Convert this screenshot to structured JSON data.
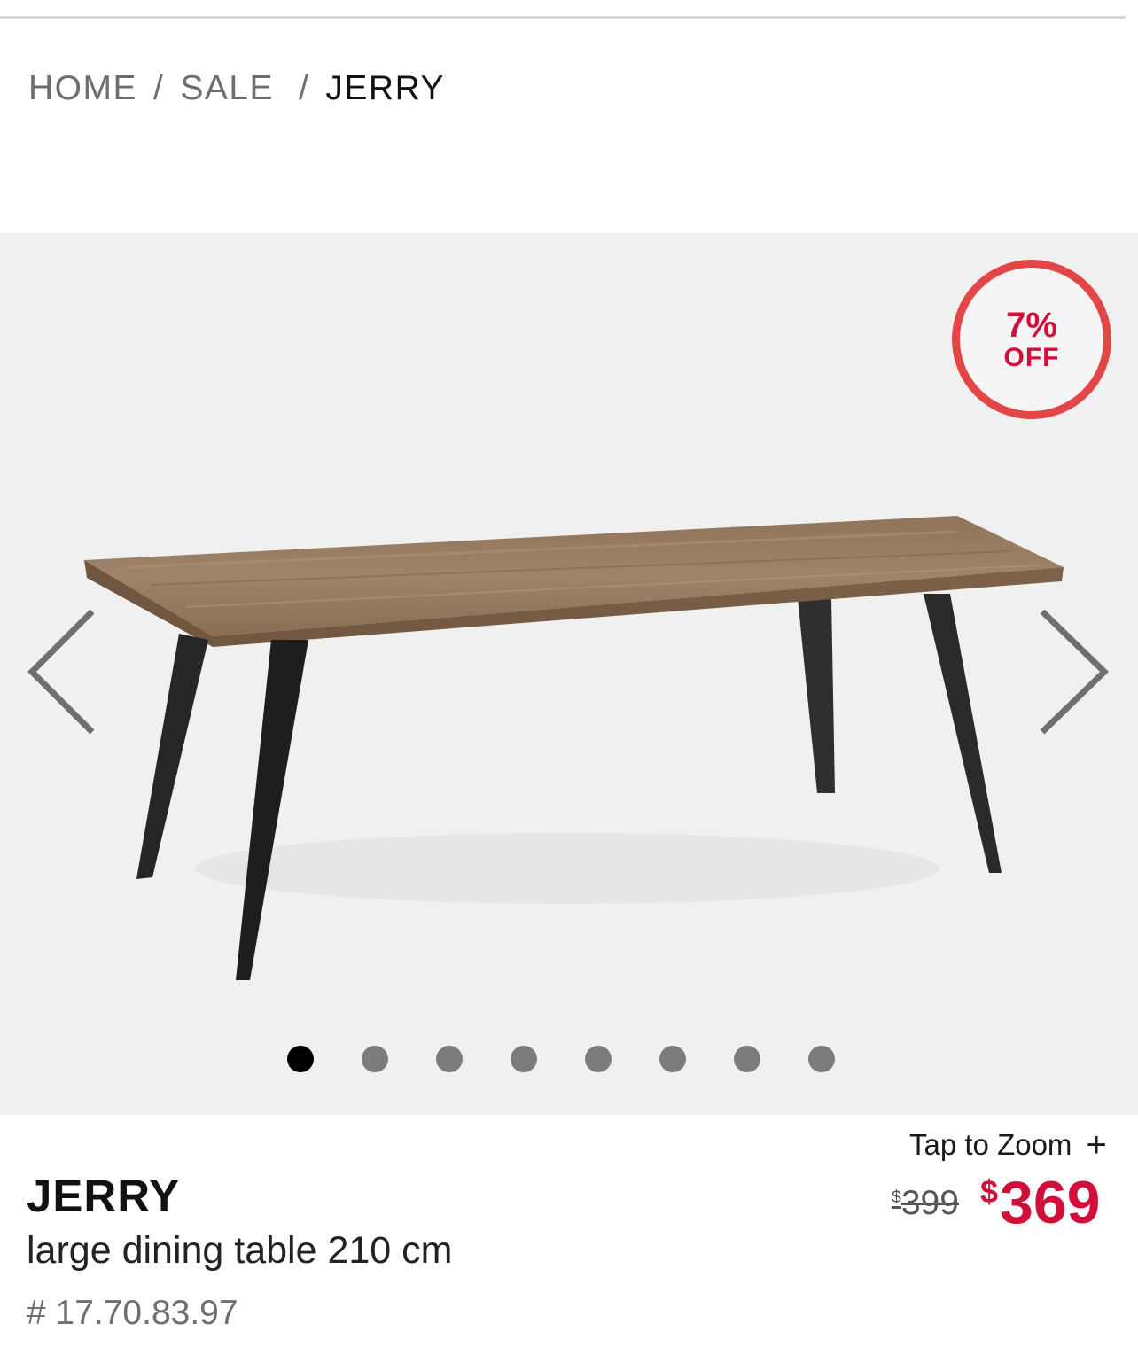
{
  "breadcrumb": {
    "home": "HOME",
    "sale": "SALE",
    "current": "JERRY",
    "separator": "/"
  },
  "gallery": {
    "badge": {
      "percent": "7%",
      "label": "OFF"
    },
    "image_alt": "JERRY large dining table",
    "slide_count": 8,
    "active_slide": 1,
    "prev_icon": "chevron-left-icon",
    "next_icon": "chevron-right-icon",
    "zoom_label": "Tap to Zoom",
    "zoom_icon": "+"
  },
  "product": {
    "name": "JERRY",
    "description": "large dining table 210 cm",
    "sku": "# 17.70.83.97"
  },
  "price": {
    "currency": "$",
    "old": "399",
    "new": "369"
  },
  "colors": {
    "sale_red": "#d0103a",
    "badge_ring": "#e24646",
    "gallery_bg": "#f0f0f0",
    "dot_inactive": "#7b7b7b",
    "dot_active": "#000000"
  }
}
